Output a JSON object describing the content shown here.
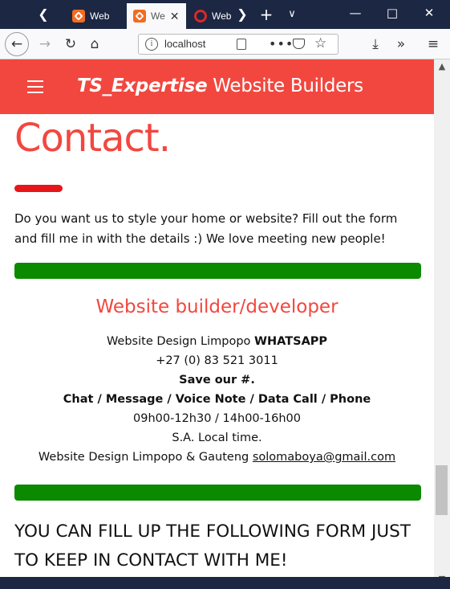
{
  "browser": {
    "tabs": [
      {
        "label": "Web"
      },
      {
        "label": "We"
      },
      {
        "label": "Web"
      }
    ],
    "url": "localhost"
  },
  "site": {
    "brand_italic": "TS_Expertise",
    "brand_rest": "Website Builders"
  },
  "contact": {
    "title": "Contact.",
    "intro": "Do you want us to style your home or website? Fill out the form and fill me in with the details :) We love meeting new people!"
  },
  "business": {
    "heading": "Website builder/developer",
    "line1_normal": "Website Design Limpopo ",
    "line1_bold": "WHATSAPP",
    "phone": "+27 (0) 83 521 3011",
    "save_note": "Save our #.",
    "channels": "Chat / Message / Voice Note / Data Call / Phone",
    "hours": "09h00-12h30 / 14h00-16h00",
    "timezone": "S.A. Local time.",
    "region": "Website Design Limpopo & Gauteng",
    "email": "solomaboya@gmail.com"
  },
  "form": {
    "heading": "YOU CAN FILL UP THE FOLLOWING FORM JUST TO KEEP IN CONTACT WITH ME!"
  },
  "colors": {
    "header_bg": "#f2473f",
    "accent_red": "#e6161b",
    "green_bar": "#0b8a00",
    "browser_chrome": "#1c2743"
  }
}
